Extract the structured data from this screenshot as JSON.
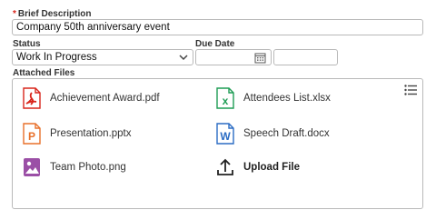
{
  "brief_description": {
    "required_mark": "*",
    "label": "Brief Description",
    "value": "Company 50th anniversary event"
  },
  "status": {
    "label": "Status",
    "value": "Work In Progress",
    "icon": "chevron-down-icon"
  },
  "due_date": {
    "label": "Due Date",
    "date_value": "",
    "time_value": "",
    "icon": "calendar-icon"
  },
  "attached_files": {
    "label": "Attached Files",
    "menu_icon": "list-menu-icon",
    "files": [
      {
        "name": "Achievement Award.pdf",
        "icon": "pdf-file-icon",
        "color": "#d9261c"
      },
      {
        "name": "Attendees List.xlsx",
        "icon": "excel-file-icon",
        "color": "#1f9d55"
      },
      {
        "name": "Presentation.pptx",
        "icon": "powerpoint-file-icon",
        "color": "#e8702a"
      },
      {
        "name": "Speech Draft.docx",
        "icon": "word-file-icon",
        "color": "#2b6cc4"
      },
      {
        "name": "Team Photo.png",
        "icon": "image-file-icon",
        "color": "#9b4fa6"
      }
    ],
    "upload_label": "Upload File",
    "upload_icon": "upload-icon"
  }
}
